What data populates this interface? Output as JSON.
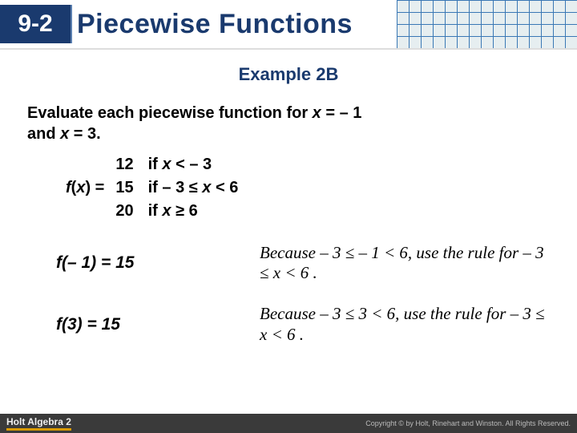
{
  "header": {
    "lesson_number": "9-2",
    "title": "Piecewise Functions"
  },
  "example_label": "Example 2B",
  "prompt": {
    "line1_a": "Evaluate each piecewise function for ",
    "line1_b": " = – 1",
    "line2_a": "and ",
    "line2_b": " = 3."
  },
  "fn": {
    "lhs_f": "f",
    "lhs_open": "(",
    "lhs_x": "x",
    "lhs_close": ") = ",
    "values": [
      "12",
      "15",
      "20"
    ],
    "conds": [
      "if x < – 3",
      "if – 3 ≤ x < 6",
      "if x ≥ 6"
    ]
  },
  "evals": [
    {
      "left": "f(– 1) = 15",
      "right": "Because  – 3 ≤ – 1 < 6, use the rule for – 3 ≤ x < 6 ."
    },
    {
      "left": "f(3) = 15",
      "right": "Because  – 3 ≤ 3 < 6, use the rule for – 3 ≤ x < 6 ."
    }
  ],
  "footer": {
    "left": "Holt Algebra 2",
    "right": "Copyright © by Holt, Rinehart and Winston. All Rights Reserved."
  }
}
